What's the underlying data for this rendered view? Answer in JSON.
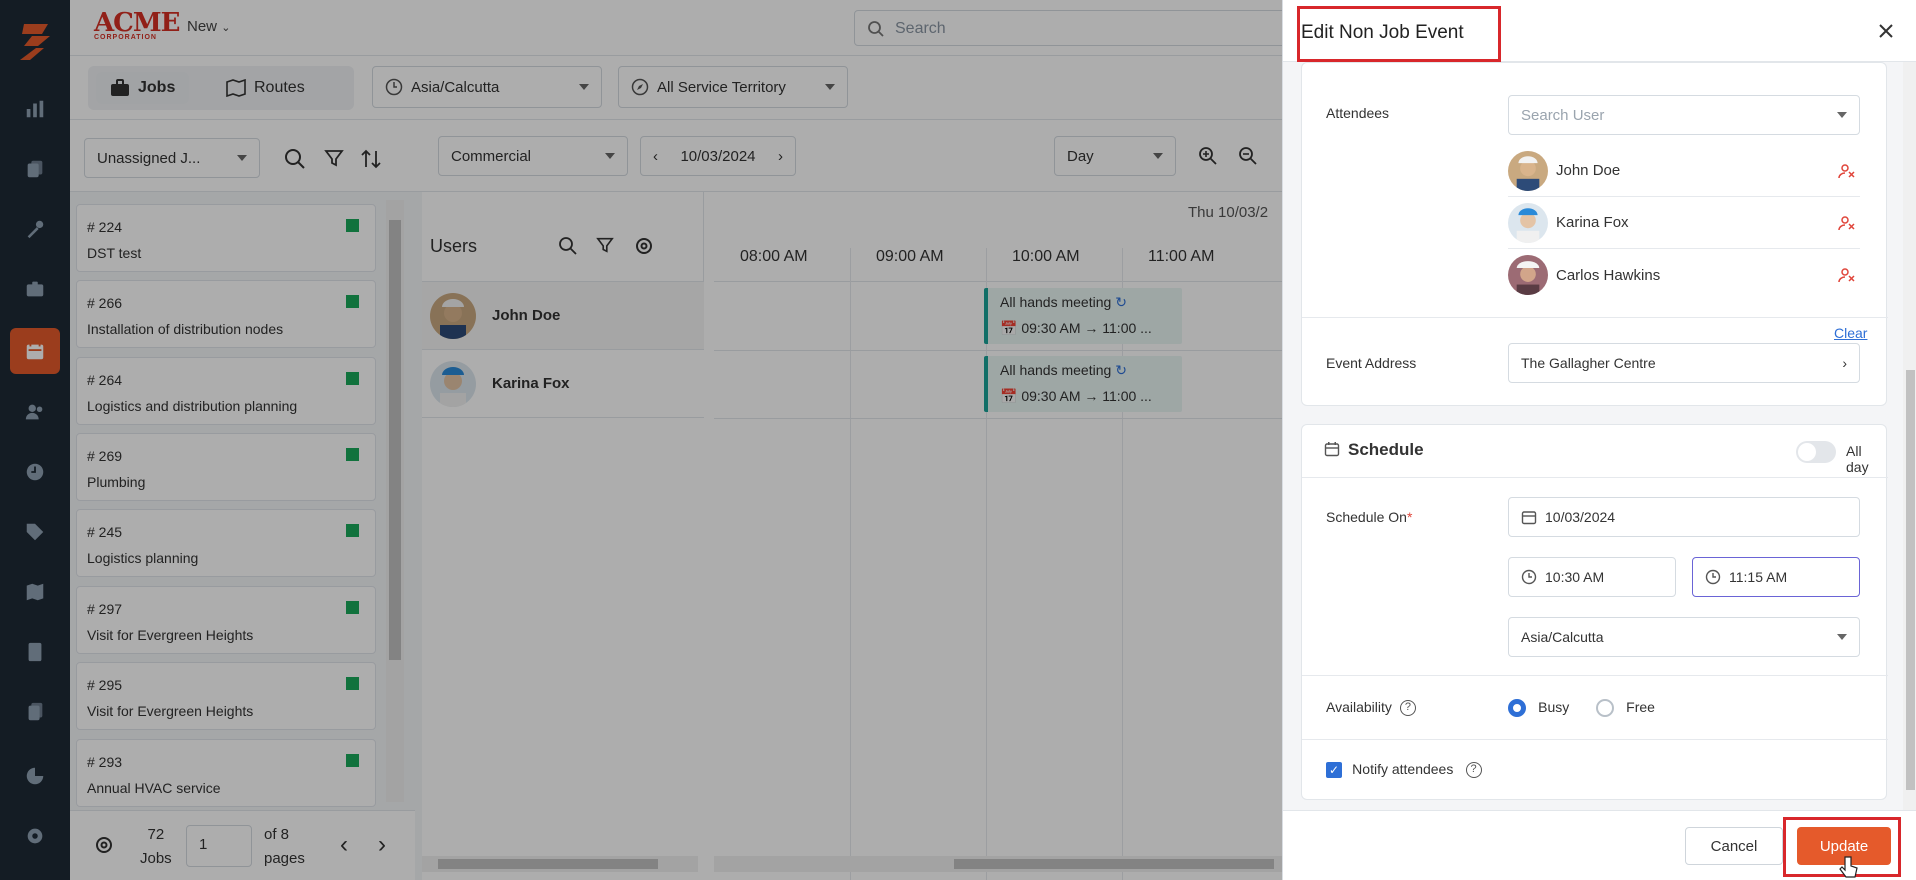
{
  "header": {
    "brand": "ACME",
    "brand_sub": "CORPORATION",
    "new_label": "New",
    "search_placeholder": "Search"
  },
  "toolbar": {
    "jobs_label": "Jobs",
    "routes_label": "Routes",
    "timezone": "Asia/Calcutta",
    "territory": "All Service Territory"
  },
  "filters": {
    "unassigned": "Unassigned J...",
    "category": "Commercial",
    "date": "10/03/2024",
    "view": "Day",
    "date_header": "Thu 10/03/2"
  },
  "jobs": [
    {
      "num": "# 224",
      "title": "DST test"
    },
    {
      "num": "# 266",
      "title": "Installation of distribution nodes"
    },
    {
      "num": "# 264",
      "title": "Logistics and distribution planning"
    },
    {
      "num": "# 269",
      "title": "Plumbing"
    },
    {
      "num": "# 245",
      "title": "Logistics planning"
    },
    {
      "num": "# 297",
      "title": "Visit for Evergreen Heights"
    },
    {
      "num": "# 295",
      "title": "Visit for Evergreen Heights"
    },
    {
      "num": "# 293",
      "title": "Annual HVAC service"
    }
  ],
  "pager": {
    "count": "72",
    "count_unit": "Jobs",
    "page": "1",
    "of_pages": "of 8",
    "pages_word": "pages"
  },
  "scheduler": {
    "users_title": "Users",
    "hours": [
      "08:00 AM",
      "09:00 AM",
      "10:00 AM",
      "11:00 AM"
    ],
    "users": [
      {
        "name": "John Doe",
        "event_title": "All hands meeting",
        "event_time": "09:30 AM",
        "event_end": "11:00 ..."
      },
      {
        "name": "Karina Fox",
        "event_title": "All hands meeting",
        "event_time": "09:30 AM",
        "event_end": "11:00 ..."
      }
    ]
  },
  "drawer": {
    "title": "Edit Non Job Event",
    "attendees_label": "Attendees",
    "search_user_placeholder": "Search User",
    "attendees": [
      "John Doe",
      "Karina Fox",
      "Carlos Hawkins"
    ],
    "clear_label": "Clear",
    "address_label": "Event Address",
    "address_value": "The Gallagher Centre",
    "schedule_title": "Schedule",
    "allday_label": "All day",
    "schedule_on_label": "Schedule On",
    "required_mark": "*",
    "schedule_date": "10/03/2024",
    "start_time": "10:30 AM",
    "end_time": "11:15 AM",
    "timezone": "Asia/Calcutta",
    "availability_label": "Availability",
    "busy_label": "Busy",
    "free_label": "Free",
    "notify_label": "Notify attendees",
    "cancel_label": "Cancel",
    "update_label": "Update"
  },
  "colors": {
    "accent": "#e55a2b",
    "sidebar": "#1e2a36",
    "highlight": "#d8272b",
    "job_status": "#1aa95a"
  }
}
